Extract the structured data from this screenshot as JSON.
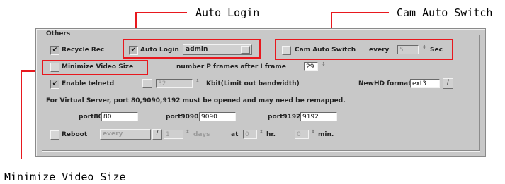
{
  "callouts": {
    "auto_login": "Auto Login",
    "cam_auto_switch": "Cam Auto Switch",
    "minimize_video_size": "Minimize Video Size"
  },
  "group": {
    "title": "Others"
  },
  "row1": {
    "recycle_rec": {
      "check": "✔",
      "label": "Recycle Rec"
    },
    "auto_login": {
      "check": "✔",
      "label": "Auto Login",
      "user": "admin"
    },
    "cam_auto_switch": {
      "label": "Cam Auto Switch",
      "every_label": "every",
      "value": "5",
      "unit": "Sec"
    }
  },
  "row2": {
    "minimize_video_size": {
      "label": "Minimize Video Size"
    },
    "iframes": {
      "label": "number P frames after I frame",
      "value": "29"
    }
  },
  "row3": {
    "enable_telnetd": {
      "check": "✔",
      "label": "Enable telnetd"
    },
    "bandwidth": {
      "value": "32",
      "label": "Kbit(Limit out bandwidth)"
    },
    "newhd": {
      "label": "NewHD format",
      "value": "ext3"
    }
  },
  "note": "For Virtual Server, port 80,9090,9192 must be opened and may need be remapped.",
  "ports": {
    "port80": {
      "label": "port80",
      "value": "80"
    },
    "port9090": {
      "label": "port9090",
      "value": "9090"
    },
    "port9192": {
      "label": "port9192",
      "value": "9192"
    }
  },
  "reboot": {
    "label": "Reboot",
    "period": "every",
    "days_value": "1",
    "days_label": "days",
    "at_label": "at",
    "hr_value": "0",
    "hr_label": "hr.",
    "min_value": "0",
    "min_label": "min."
  },
  "icons": {
    "spin": "⇕",
    "tool": "∕"
  }
}
